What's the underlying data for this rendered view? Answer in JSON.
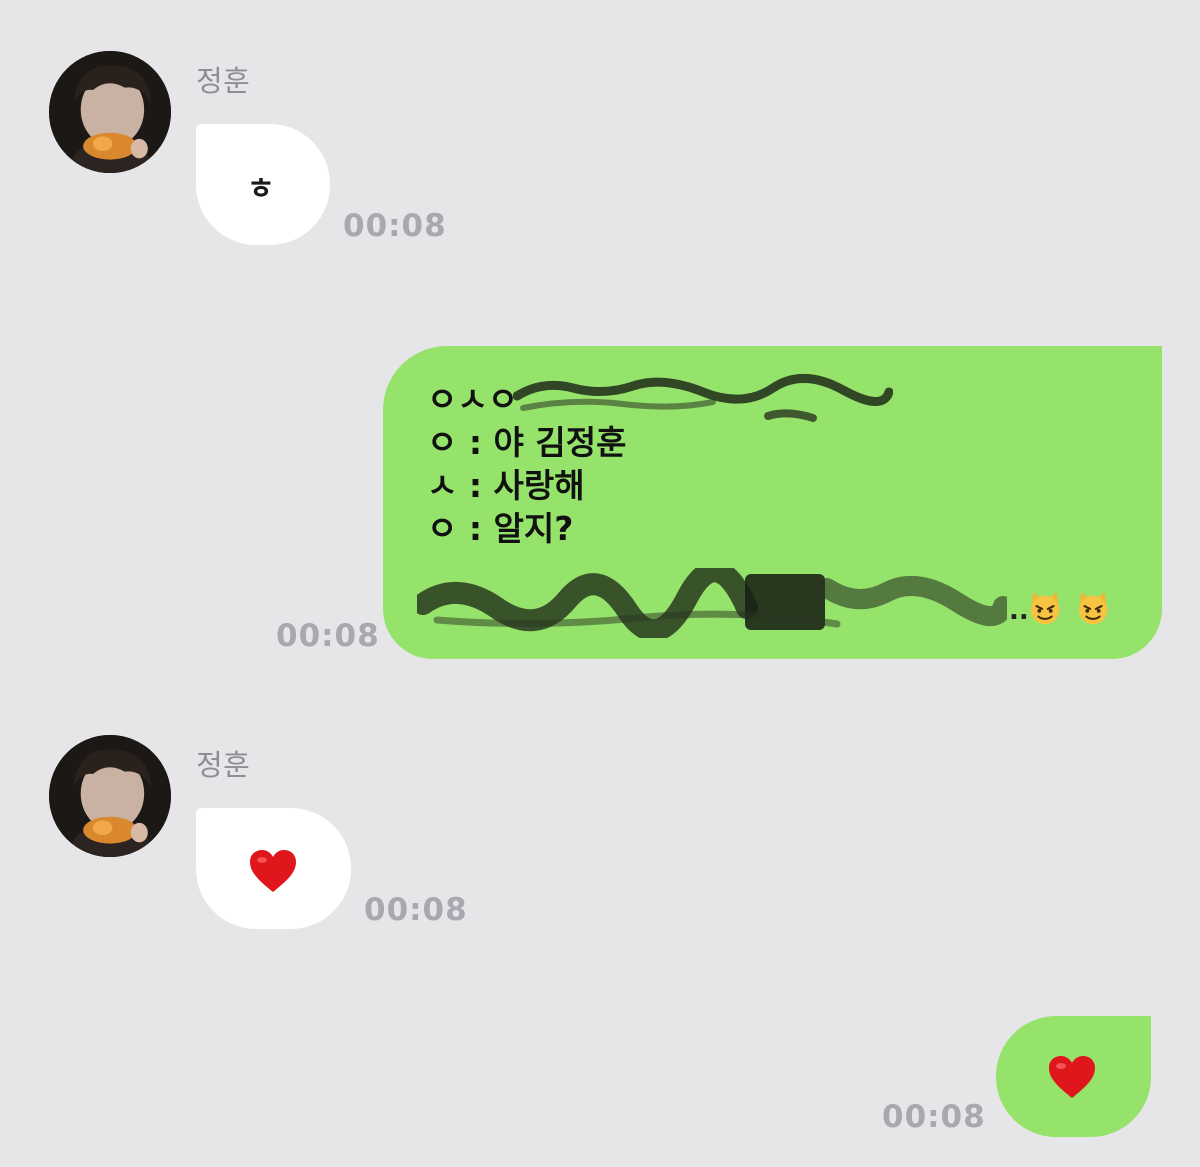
{
  "contact": {
    "name": "정훈"
  },
  "messages": [
    {
      "from": "contact",
      "text": "ㅎ",
      "time": "00:08"
    },
    {
      "from": "me",
      "lines": [
        "ㅇㅅㅇ",
        "ㅇ : 야 김정훈",
        "ㅅ : 사랑해",
        "ㅇ : 알지?"
      ],
      "emoji": [
        "smiling-cat-face-with-horns",
        "smiling-cat-face-with-horns"
      ],
      "redacted": true,
      "time": "00:08"
    },
    {
      "from": "contact",
      "emoji": "red-heart",
      "time": "00:08"
    },
    {
      "from": "me",
      "emoji": "red-heart",
      "time": "00:08"
    }
  ],
  "colors": {
    "background": "#e6e6e8",
    "incoming_bubble": "#ffffff",
    "outgoing_bubble": "#95e36b",
    "timestamp": "#a7a8b0",
    "heart": "#e0161d"
  }
}
